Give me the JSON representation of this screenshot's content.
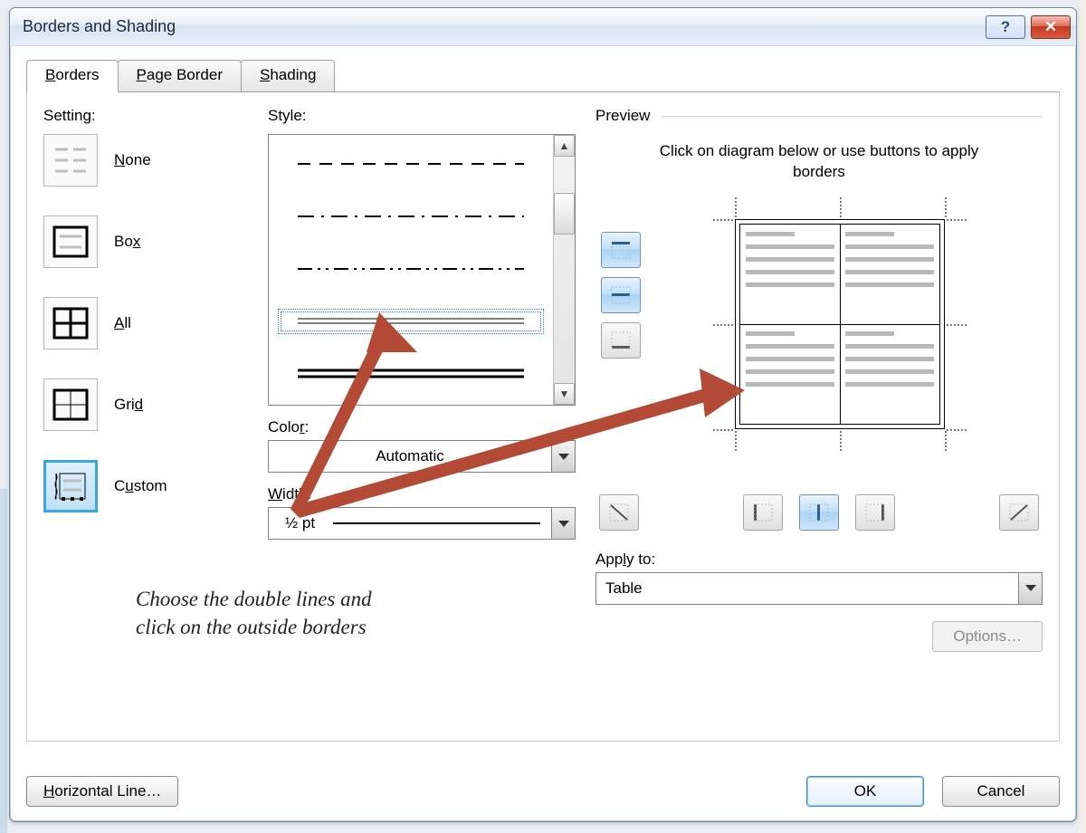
{
  "window": {
    "title": "Borders and Shading"
  },
  "tabs": {
    "borders": "Borders",
    "page_border": "Page Border",
    "shading": "Shading"
  },
  "setting": {
    "header": "Setting:",
    "none": "None",
    "box": "Box",
    "all": "All",
    "grid": "Grid",
    "custom": "Custom"
  },
  "style": {
    "header": "Style:"
  },
  "color": {
    "header": "Color:",
    "value": "Automatic"
  },
  "width": {
    "header": "Width:",
    "value": "½ pt"
  },
  "preview": {
    "header": "Preview",
    "hint": "Click on diagram below or use buttons to apply borders"
  },
  "applyto": {
    "header": "Apply to:",
    "value": "Table"
  },
  "options_label": "Options…",
  "footer": {
    "horizontal_line": "Horizontal Line…",
    "ok": "OK",
    "cancel": "Cancel"
  },
  "annotation": {
    "line1": "Choose the double lines and",
    "line2": "click on the outside borders"
  }
}
